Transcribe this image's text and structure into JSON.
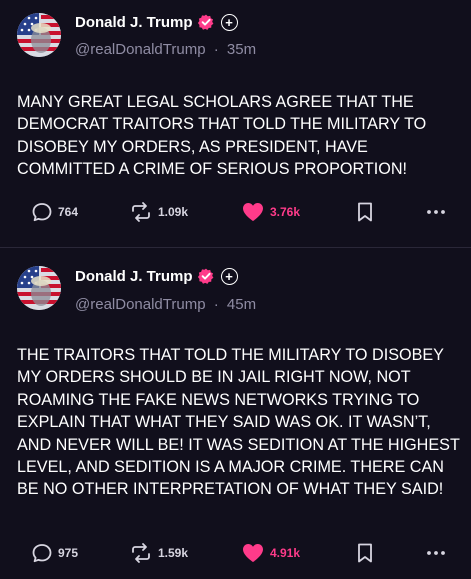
{
  "colors": {
    "background": "#110f1c",
    "text": "#ffffff",
    "muted": "#8f8ca3",
    "like_accent": "#ff3b8a",
    "verified_badge": "#ff3b8a"
  },
  "posts": [
    {
      "author": {
        "display_name": "Donald J. Trump",
        "handle": "@realDonaldTrump",
        "verified": true,
        "verified_icon": "verified-badge-icon",
        "add_icon": "plus-circle-icon"
      },
      "time_separator": "·",
      "time": "35m",
      "text": "MANY GREAT LEGAL SCHOLARS AGREE THAT THE DEMOCRAT TRAITORS THAT TOLD THE MILITARY TO DISOBEY MY ORDERS, AS PRESIDENT, HAVE COMMITTED A CRIME OF SERIOUS PROPORTION!",
      "actions": {
        "replies": "764",
        "retruths": "1.09k",
        "likes": "3.76k",
        "liked": true
      }
    },
    {
      "author": {
        "display_name": "Donald J. Trump",
        "handle": "@realDonaldTrump",
        "verified": true,
        "verified_icon": "verified-badge-icon",
        "add_icon": "plus-circle-icon"
      },
      "time_separator": "·",
      "time": "45m",
      "text": "THE TRAITORS THAT TOLD THE MILITARY TO DISOBEY MY ORDERS SHOULD BE IN JAIL RIGHT NOW, NOT ROAMING THE FAKE NEWS NETWORKS TRYING TO EXPLAIN THAT WHAT THEY SAID WAS OK. IT WASN’T, AND NEVER WILL BE! IT WAS SEDITION AT THE HIGHEST LEVEL, AND SEDITION IS A MAJOR CRIME. THERE CAN BE NO OTHER INTERPRETATION OF WHAT THEY SAID!",
      "actions": {
        "replies": "975",
        "retruths": "1.59k",
        "likes": "4.91k",
        "liked": true
      }
    }
  ]
}
